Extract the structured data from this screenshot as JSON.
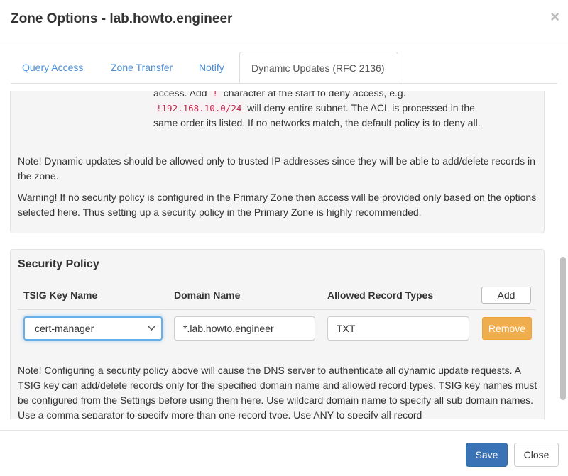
{
  "modal": {
    "title": "Zone Options - lab.howto.engineer",
    "close_glyph": "×"
  },
  "tabs": [
    {
      "label": "Query Access",
      "active": false
    },
    {
      "label": "Zone Transfer",
      "active": false
    },
    {
      "label": "Notify",
      "active": false
    },
    {
      "label": "Dynamic Updates (RFC 2136)",
      "active": true
    }
  ],
  "acl_help": {
    "line1_a": "access. Add ",
    "bang": "!",
    "line1_b": " character at the start to deny access, e.g.",
    "example": "!192.168.10.0/24",
    "line2_b": " will deny entire subnet. The ACL is processed in the same order its listed. If no networks match, the default policy is to deny all."
  },
  "note_dynamic": "Note! Dynamic updates should be allowed only to trusted IP addresses since they will be able to add/delete records in the zone.",
  "warning_policy": "Warning! If no security policy is configured in the Primary Zone then access will be provided only based on the options selected here. Thus setting up a security policy in the Primary Zone is highly recommended.",
  "security_policy": {
    "title": "Security Policy",
    "columns": {
      "tsig": "TSIG Key Name",
      "domain": "Domain Name",
      "types": "Allowed Record Types"
    },
    "add_label": "Add",
    "rows": [
      {
        "tsig_key": "cert-manager",
        "domain": "*.lab.howto.engineer",
        "types": "TXT",
        "remove_label": "Remove"
      }
    ],
    "note": "Note! Configuring a security policy above will cause the DNS server to authenticate all dynamic update requests. A TSIG key can add/delete records only for the specified domain name and allowed record types. TSIG key names must be configured from the Settings before using them here. Use wildcard domain name to specify all sub domain names. Use a comma separator to specify more than one record type. Use ANY to specify all record"
  },
  "footer": {
    "save_label": "Save",
    "close_label": "Close"
  },
  "colors": {
    "link": "#4a8fd6",
    "primary": "#3a73b5",
    "warning": "#f0ad4e",
    "code": "#c7254e"
  }
}
